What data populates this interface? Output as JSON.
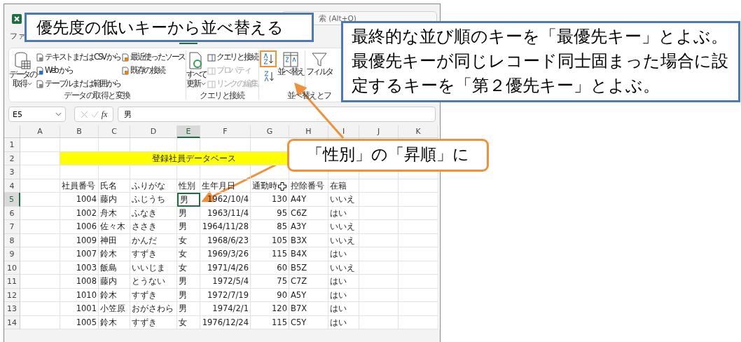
{
  "title_bar": {
    "tab_fragment": "ファ",
    "search_fragment": "索 (Alt+Q)"
  },
  "ribbon": {
    "groups": [
      {
        "kind": "data",
        "label": "データの取得と変換",
        "big": {
          "line1": "データの",
          "line2": "取得"
        },
        "items": [
          {
            "text": "テキストまたは CSV から",
            "disabled": false
          },
          {
            "text": "Web から",
            "disabled": false
          },
          {
            "text": "テーブルまたは範囲から",
            "disabled": false
          },
          {
            "text": "最近使ったソース",
            "disabled": false
          },
          {
            "text": "既存の接続",
            "disabled": false
          }
        ]
      },
      {
        "kind": "query",
        "label": "クエリと接続",
        "big": {
          "line1": "すべて",
          "line2": "更新"
        },
        "items": [
          {
            "text": "クエリと接続",
            "disabled": false
          },
          {
            "text": "プロパティ",
            "disabled": true
          },
          {
            "text": "リンクの編集",
            "disabled": true
          }
        ]
      },
      {
        "kind": "sort",
        "label": "並べ替えとフ",
        "sort_ascending_highlighted": true,
        "sort_button": "並べ替え",
        "filter_button": "フィルタ"
      }
    ]
  },
  "formula_bar": {
    "name_box": "E5",
    "function_label": "fx",
    "value": "男"
  },
  "sheet": {
    "columns": [
      {
        "label": "A",
        "selected": false
      },
      {
        "label": "B",
        "selected": false
      },
      {
        "label": "C",
        "selected": false
      },
      {
        "label": "D",
        "selected": false
      },
      {
        "label": "E",
        "selected": true
      },
      {
        "label": "F",
        "selected": false
      },
      {
        "label": "G",
        "selected": false
      },
      {
        "label": "H",
        "selected": false
      },
      {
        "label": "I",
        "selected": false
      },
      {
        "label": "J",
        "selected": false
      },
      {
        "label": "K",
        "selected": false
      }
    ],
    "row_numbers": [
      {
        "label": "1",
        "selected": false
      },
      {
        "label": "2",
        "selected": false
      },
      {
        "label": "3",
        "selected": false
      },
      {
        "label": "4",
        "selected": false
      },
      {
        "label": "5",
        "selected": true
      },
      {
        "label": "6",
        "selected": false
      },
      {
        "label": "7",
        "selected": false
      },
      {
        "label": "8",
        "selected": false
      },
      {
        "label": "9",
        "selected": false
      },
      {
        "label": "10",
        "selected": false
      },
      {
        "label": "11",
        "selected": false
      },
      {
        "label": "12",
        "selected": false
      },
      {
        "label": "13",
        "selected": false
      },
      {
        "label": "14",
        "selected": false
      }
    ],
    "title_cell": "登録社員データベース",
    "headers": [
      "社員番号",
      "氏名",
      "ふりがな",
      "性別",
      "生年月日",
      "通勤時",
      "控除番号",
      "在籍"
    ],
    "records": [
      {
        "id": "1004",
        "name": "藤内",
        "kana": "ふじうち",
        "gender": "男",
        "birth": "1962/10/4",
        "commute": "130",
        "code": "A4Y",
        "enrolled": "いいえ",
        "selected": true
      },
      {
        "id": "1002",
        "name": "舟木",
        "kana": "ふなき",
        "gender": "男",
        "birth": "1963/11/4",
        "commute": "95",
        "code": "C6Z",
        "enrolled": "はい",
        "selected": false
      },
      {
        "id": "1006",
        "name": "佐々木",
        "kana": "ささき",
        "gender": "男",
        "birth": "1964/11/28",
        "commute": "85",
        "code": "A3Y",
        "enrolled": "いいえ",
        "selected": false
      },
      {
        "id": "1009",
        "name": "神田",
        "kana": "かんだ",
        "gender": "女",
        "birth": "1968/6/23",
        "commute": "105",
        "code": "B3X",
        "enrolled": "いいえ",
        "selected": false
      },
      {
        "id": "1007",
        "name": "鈴木",
        "kana": "すずき",
        "gender": "女",
        "birth": "1969/3/26",
        "commute": "115",
        "code": "B4X",
        "enrolled": "はい",
        "selected": false
      },
      {
        "id": "1003",
        "name": "飯島",
        "kana": "いいじま",
        "gender": "女",
        "birth": "1971/4/26",
        "commute": "60",
        "code": "B5Z",
        "enrolled": "いいえ",
        "selected": false
      },
      {
        "id": "1008",
        "name": "藤内",
        "kana": "とうない",
        "gender": "男",
        "birth": "1972/5/4",
        "commute": "75",
        "code": "C7Z",
        "enrolled": "はい",
        "selected": false
      },
      {
        "id": "1010",
        "name": "鈴木",
        "kana": "すずき",
        "gender": "男",
        "birth": "1972/7/19",
        "commute": "90",
        "code": "A5Y",
        "enrolled": "はい",
        "selected": false
      },
      {
        "id": "1001",
        "name": "小笠原",
        "kana": "おがさわら",
        "gender": "男",
        "birth": "1974/2/1",
        "commute": "120",
        "code": "B7X",
        "enrolled": "はい",
        "selected": false
      },
      {
        "id": "1005",
        "name": "鈴木",
        "kana": "すずき",
        "gender": "女",
        "birth": "1976/12/24",
        "commute": "115",
        "code": "C5Y",
        "enrolled": "はい",
        "selected": false
      }
    ]
  },
  "annotations": [
    {
      "kind": "box",
      "text": "優先度の低いキーから並べ替える"
    },
    {
      "kind": "box_wide",
      "text": "最終的な並び順のキーを「最優先キー」とよぶ。最優先キーが同じレコード同士固まった場合に設定するキーを「第２優先キー」とよぶ。"
    },
    {
      "kind": "bubble",
      "text": "「性別」の「昇順」に"
    }
  ]
}
